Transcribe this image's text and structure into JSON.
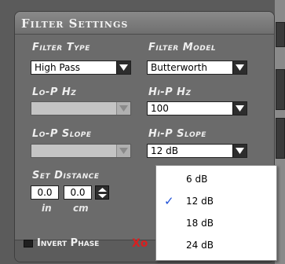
{
  "panel": {
    "title": "Filter Settings"
  },
  "filter_type": {
    "label": "Filter Type",
    "value": "High Pass"
  },
  "filter_model": {
    "label": "Filter Model",
    "value": "Butterworth"
  },
  "lo_p_hz": {
    "label": "Lo-P Hz",
    "value": ""
  },
  "hi_p_hz": {
    "label": "Hi-P Hz",
    "value": "100"
  },
  "lo_p_slope": {
    "label": "Lo-P Slope",
    "value": ""
  },
  "hi_p_slope": {
    "label": "Hi-P Slope",
    "value": "12 dB"
  },
  "set_distance": {
    "label": "Set Distance",
    "in_value": "0.0",
    "cm_value": "0.0",
    "in_unit": "in",
    "cm_unit": "cm"
  },
  "invert_phase": {
    "label": "Invert Phase"
  },
  "red_partial": "Xo",
  "slope_menu": {
    "items": [
      {
        "label": "6 dB",
        "checked": false
      },
      {
        "label": "12 dB",
        "checked": true
      },
      {
        "label": "18 dB",
        "checked": false
      },
      {
        "label": "24 dB",
        "checked": false
      }
    ],
    "check_glyph": "✓"
  },
  "colors": {
    "panel": "#6b6b6b",
    "accent_red": "#d82020",
    "check_blue": "#1e50d8"
  }
}
